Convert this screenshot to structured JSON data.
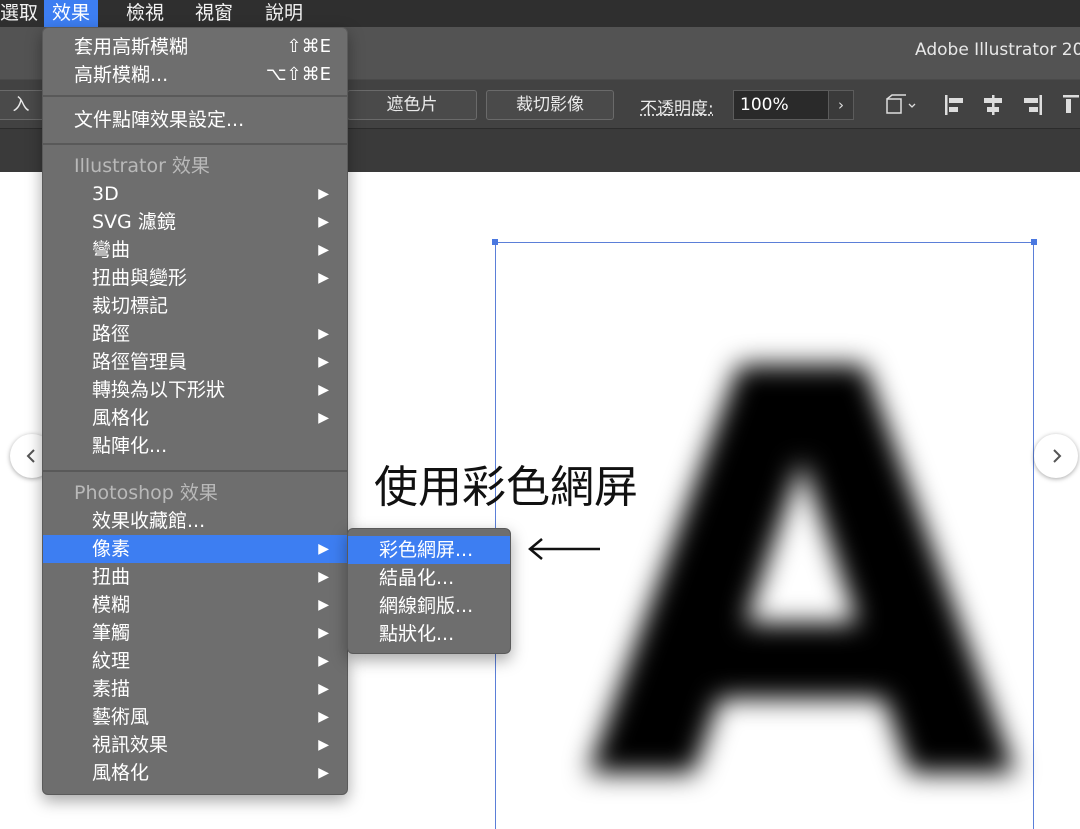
{
  "menubar": {
    "items": [
      "選取",
      "效果",
      "檢視",
      "視窗",
      "說明"
    ],
    "active_index": 1
  },
  "app": {
    "title": "Adobe Illustrator 20"
  },
  "controlbar": {
    "partial_button": "入",
    "mask_button": "遮色片",
    "crop_button": "裁切影像",
    "opacity_label": "不透明度:",
    "opacity_value": "100%",
    "chevron": "›"
  },
  "effect_menu": {
    "top_items": [
      {
        "label": "套用高斯模糊",
        "shortcut": "⇧⌘E"
      },
      {
        "label": "高斯模糊...",
        "shortcut": "⌥⇧⌘E"
      }
    ],
    "document_settings": "文件點陣效果設定...",
    "illustrator_header": "Illustrator 效果",
    "illustrator_items": [
      {
        "label": "3D",
        "submenu": true
      },
      {
        "label": "SVG 濾鏡",
        "submenu": true
      },
      {
        "label": "彎曲",
        "submenu": true
      },
      {
        "label": "扭曲與變形",
        "submenu": true
      },
      {
        "label": "裁切標記",
        "submenu": false
      },
      {
        "label": "路徑",
        "submenu": true
      },
      {
        "label": "路徑管理員",
        "submenu": true
      },
      {
        "label": "轉換為以下形狀",
        "submenu": true
      },
      {
        "label": "風格化",
        "submenu": true
      },
      {
        "label": "點陣化...",
        "submenu": false
      }
    ],
    "photoshop_header": "Photoshop 效果",
    "photoshop_items": [
      {
        "label": "效果收藏館...",
        "submenu": false
      },
      {
        "label": "像素",
        "submenu": true,
        "highlighted": true
      },
      {
        "label": "扭曲",
        "submenu": true
      },
      {
        "label": "模糊",
        "submenu": true
      },
      {
        "label": "筆觸",
        "submenu": true
      },
      {
        "label": "紋理",
        "submenu": true
      },
      {
        "label": "素描",
        "submenu": true
      },
      {
        "label": "藝術風",
        "submenu": true
      },
      {
        "label": "視訊效果",
        "submenu": true
      },
      {
        "label": "風格化",
        "submenu": true
      }
    ]
  },
  "pixel_submenu": {
    "items": [
      {
        "label": "彩色網屏...",
        "highlighted": true
      },
      {
        "label": "結晶化..."
      },
      {
        "label": "網線銅版..."
      },
      {
        "label": "點狀化..."
      }
    ]
  },
  "annotation": {
    "text": "使用彩色網屏",
    "arrow": "⟵"
  },
  "canvas": {
    "letter": "A"
  },
  "colors": {
    "highlight": "#3d7ef2",
    "menu_bg": "#6e6e6e",
    "selection": "#4a78e0"
  }
}
